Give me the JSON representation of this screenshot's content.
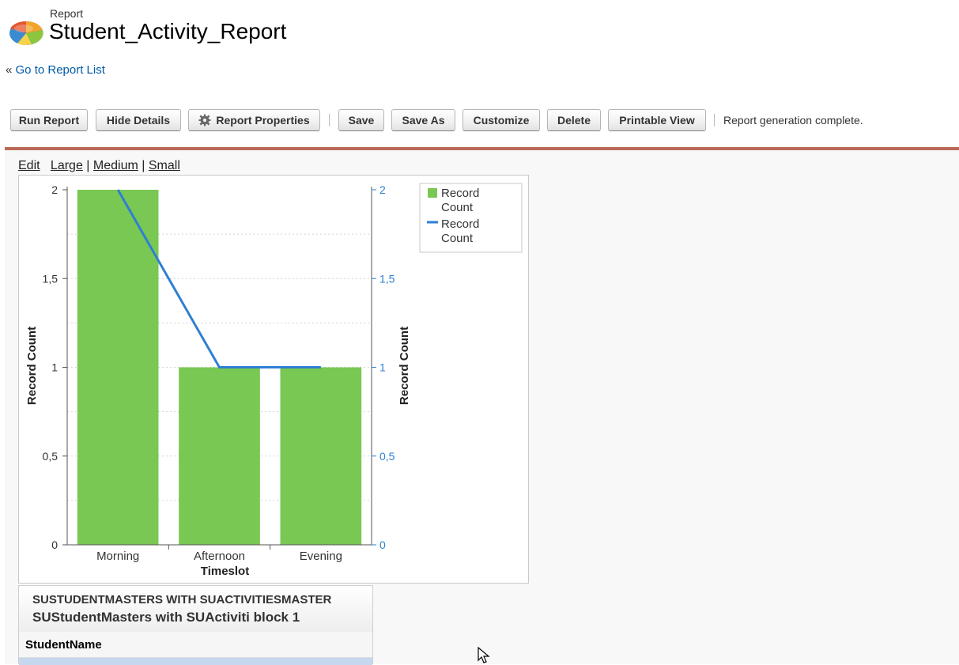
{
  "header": {
    "kicker": "Report",
    "title": "Student_Activity_Report"
  },
  "nav": {
    "back_prefix": "«",
    "back_link": "Go to Report List"
  },
  "toolbar": {
    "run_report": "Run Report",
    "hide_details": "Hide Details",
    "report_properties": "Report Properties",
    "save": "Save",
    "save_as": "Save As",
    "customize": "Customize",
    "delete": "Delete",
    "printable_view": "Printable View",
    "status": "Report generation complete."
  },
  "chart_sizes": {
    "edit": "Edit",
    "large": "Large",
    "sep1": "|",
    "medium": "Medium",
    "sep2": "|",
    "small": "Small"
  },
  "chart_data": {
    "type": "bar",
    "categories": [
      "Morning",
      "Afternoon",
      "Evening"
    ],
    "series": [
      {
        "name": "Record Count",
        "kind": "bar",
        "axis": "left",
        "color": "#78c853",
        "values": [
          2,
          1,
          1
        ]
      },
      {
        "name": "Record Count",
        "kind": "line",
        "axis": "right",
        "color": "#2f7fd3",
        "values": [
          2,
          1,
          1
        ]
      }
    ],
    "xlabel": "Timeslot",
    "ylabel": "Record Count",
    "y2label": "Record Count",
    "ylim": [
      0,
      2
    ],
    "yticks": [
      "0",
      "0,5",
      "1",
      "1,5",
      "2"
    ],
    "ytick_values": [
      0,
      0.5,
      1,
      1.5,
      2
    ],
    "grid": "horizontal dotted",
    "legend": "top-right",
    "legend_entries": [
      "Record Count",
      "Record Count"
    ],
    "right_axis_color": "#2f7fd3"
  },
  "block": {
    "title_upper": "SUSTUDENTMASTERS WITH SUACTIVITIESMASTER",
    "title": "SUStudentMasters with SUActiviti block 1",
    "column": "StudentName"
  }
}
